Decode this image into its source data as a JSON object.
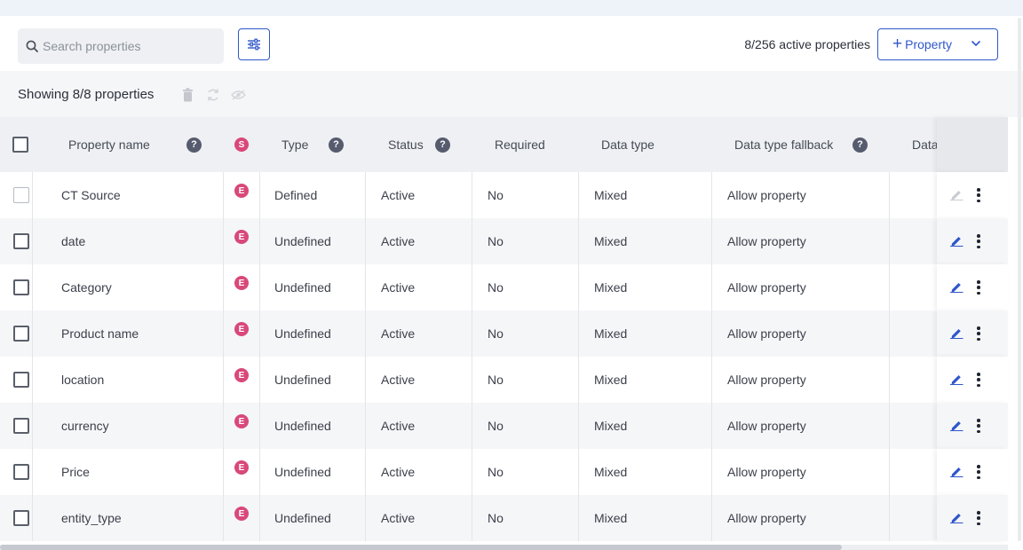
{
  "toolbar": {
    "search_placeholder": "Search properties",
    "active_count": "8/256 active properties",
    "add_property_label": "Property"
  },
  "subbar": {
    "showing": "Showing 8/8 properties"
  },
  "table": {
    "headers": {
      "property_name": "Property name",
      "s_badge": "S",
      "type": "Type",
      "status": "Status",
      "required": "Required",
      "data_type": "Data type",
      "data_type_fallback": "Data type fallback",
      "data_cut": "Data"
    },
    "rows": [
      {
        "name": "CT Source",
        "badge": "E",
        "type": "Defined",
        "status": "Active",
        "required": "No",
        "data_type": "Mixed",
        "fallback": "Allow property",
        "editable": false
      },
      {
        "name": "date",
        "badge": "E",
        "type": "Undefined",
        "status": "Active",
        "required": "No",
        "data_type": "Mixed",
        "fallback": "Allow property",
        "editable": true
      },
      {
        "name": "Category",
        "badge": "E",
        "type": "Undefined",
        "status": "Active",
        "required": "No",
        "data_type": "Mixed",
        "fallback": "Allow property",
        "editable": true
      },
      {
        "name": "Product name",
        "badge": "E",
        "type": "Undefined",
        "status": "Active",
        "required": "No",
        "data_type": "Mixed",
        "fallback": "Allow property",
        "editable": true
      },
      {
        "name": "location",
        "badge": "E",
        "type": "Undefined",
        "status": "Active",
        "required": "No",
        "data_type": "Mixed",
        "fallback": "Allow property",
        "editable": true
      },
      {
        "name": "currency",
        "badge": "E",
        "type": "Undefined",
        "status": "Active",
        "required": "No",
        "data_type": "Mixed",
        "fallback": "Allow property",
        "editable": true
      },
      {
        "name": "Price",
        "badge": "E",
        "type": "Undefined",
        "status": "Active",
        "required": "No",
        "data_type": "Mixed",
        "fallback": "Allow property",
        "editable": true
      },
      {
        "name": "entity_type",
        "badge": "E",
        "type": "Undefined",
        "status": "Active",
        "required": "No",
        "data_type": "Mixed",
        "fallback": "Allow property",
        "editable": true
      }
    ]
  },
  "colors": {
    "accent": "#2f57c9",
    "badge": "#d9487a",
    "help_icon": "#565b6e"
  },
  "icons": {
    "search": "search-icon",
    "filter": "sliders-icon",
    "delete": "trash-icon",
    "refresh": "refresh-icon",
    "visibility": "eye-off-icon",
    "help": "question-icon",
    "edit": "pencil-icon",
    "more": "kebab-icon",
    "dropdown": "chevron-down-icon"
  }
}
